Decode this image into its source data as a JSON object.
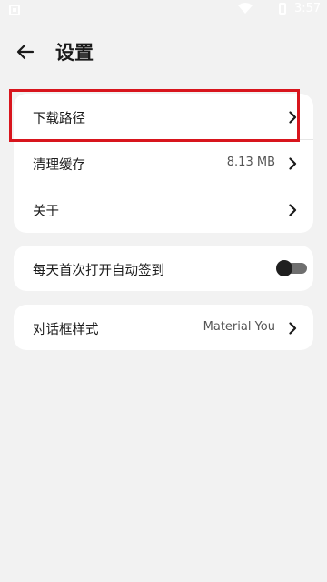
{
  "status_bar": {
    "time": "3:57",
    "icons": [
      "app-notification-icon",
      "wifi-icon",
      "battery-icon"
    ]
  },
  "header": {
    "back_icon": "arrow-left-icon",
    "title": "设置"
  },
  "settings": {
    "group1": [
      {
        "label": "下载路径",
        "value": ""
      },
      {
        "label": "清理缓存",
        "value": "8.13 MB"
      },
      {
        "label": "关于",
        "value": ""
      }
    ],
    "auto_checkin": {
      "label": "每天首次打开自动签到",
      "enabled": false
    },
    "dialog_style": {
      "label": "对话框样式",
      "value": "Material You"
    }
  },
  "colors": {
    "background": "#f2f2f2",
    "card": "#ffffff",
    "highlight": "#d8151d"
  }
}
